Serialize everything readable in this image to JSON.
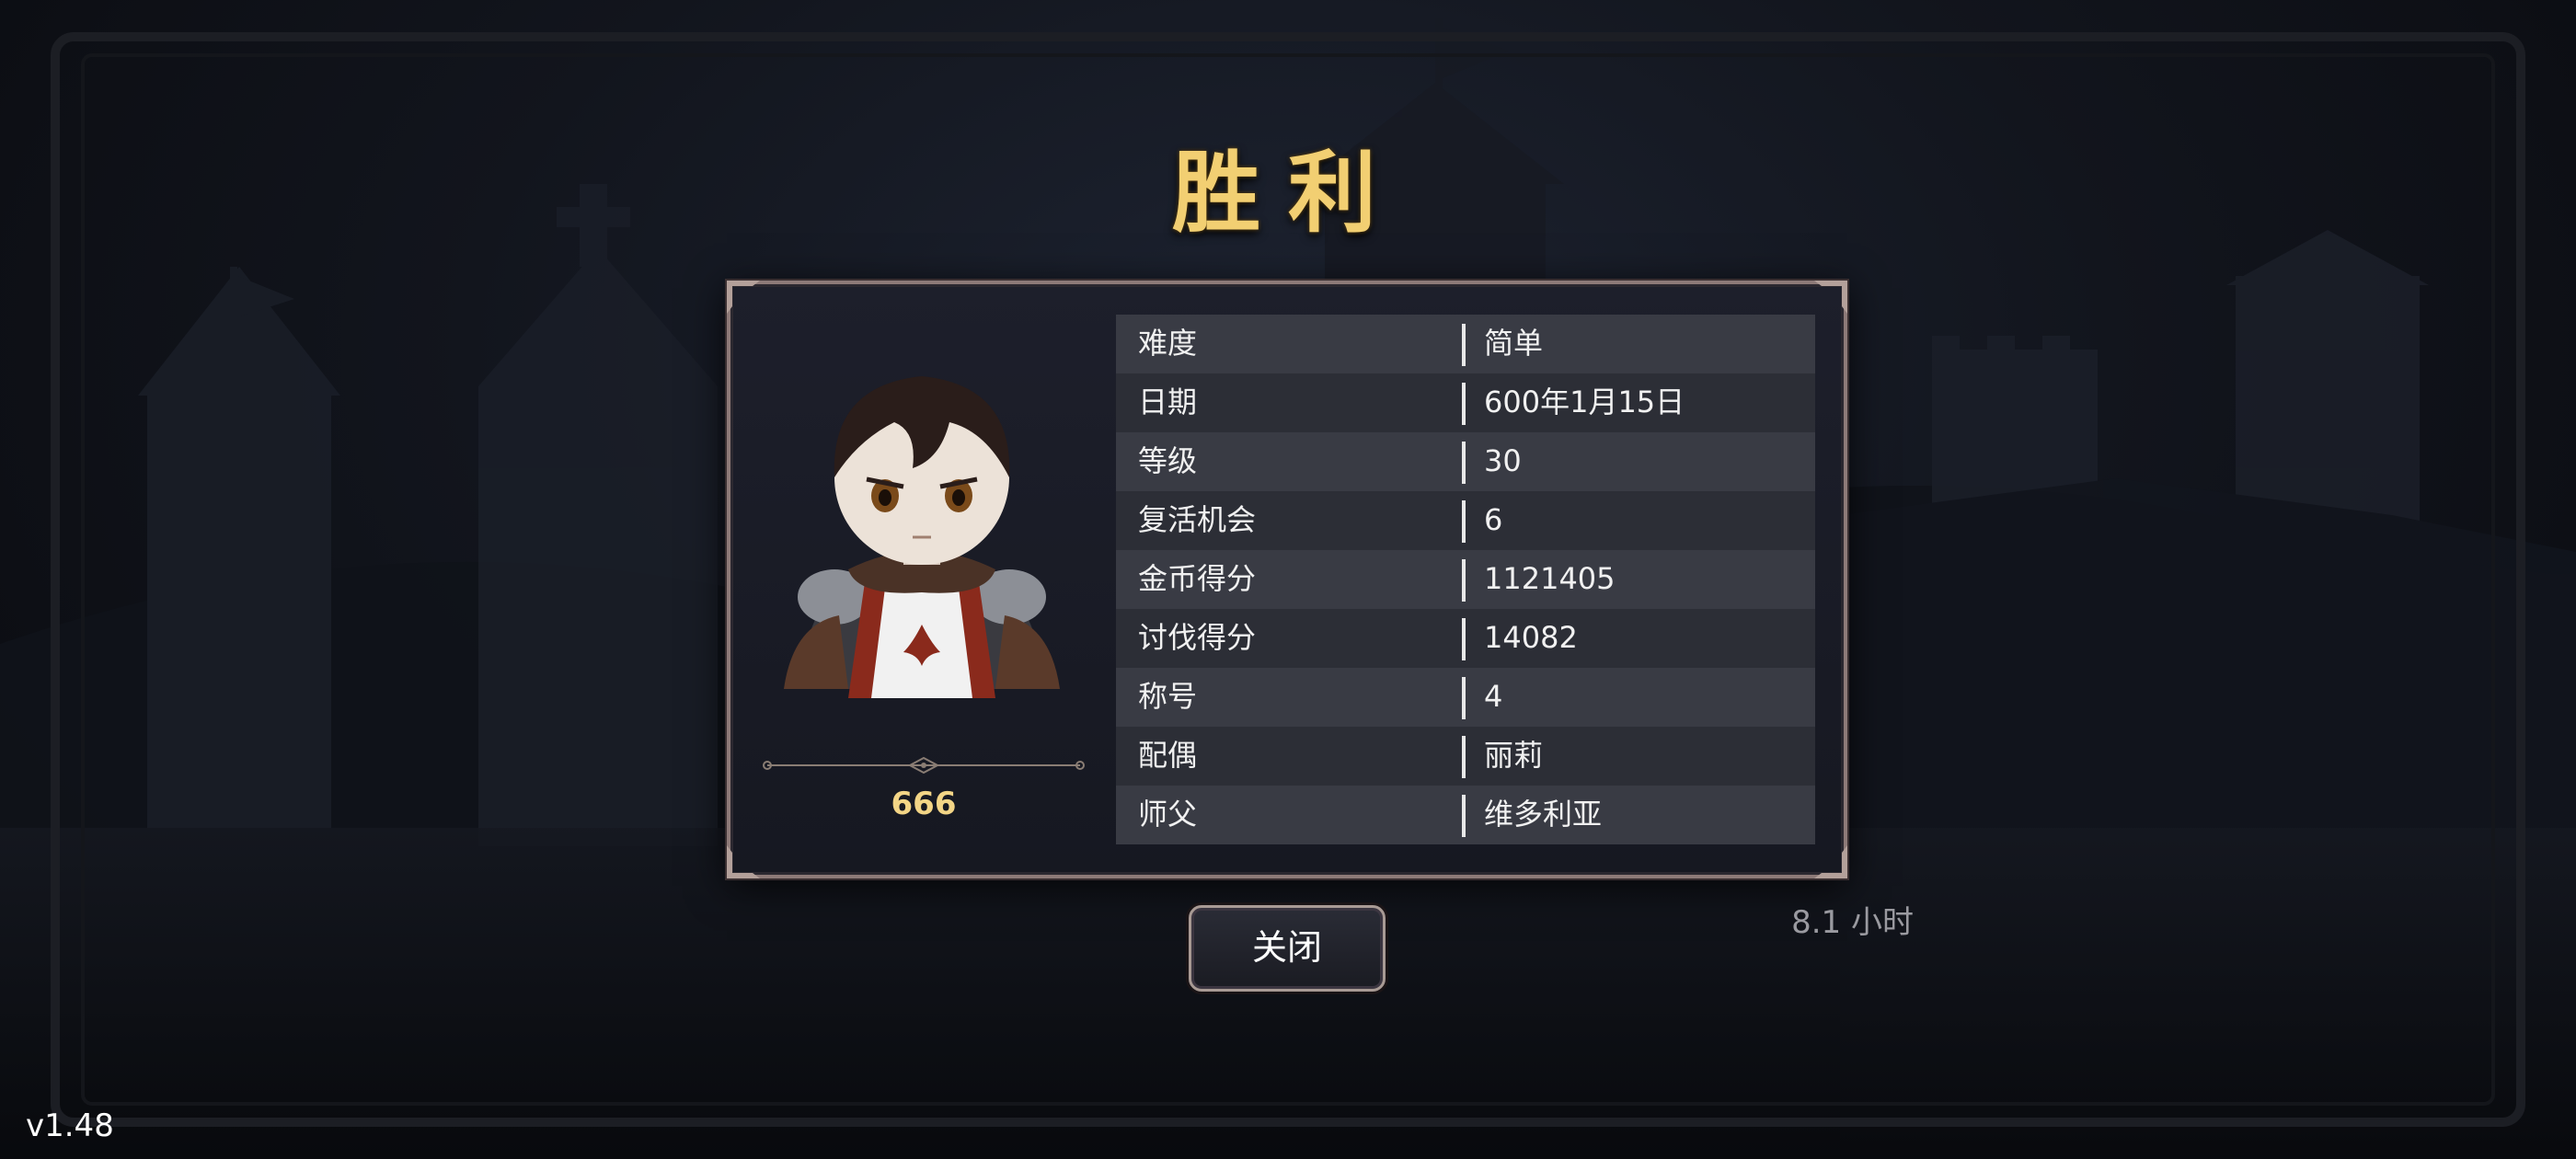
{
  "title": "胜利",
  "hero": {
    "score": "666"
  },
  "stats": [
    {
      "label": "难度",
      "value": "简单"
    },
    {
      "label": "日期",
      "value": "600年1月15日"
    },
    {
      "label": "等级",
      "value": "30"
    },
    {
      "label": "复活机会",
      "value": "6"
    },
    {
      "label": "金币得分",
      "value": "1121405"
    },
    {
      "label": "讨伐得分",
      "value": "14082"
    },
    {
      "label": "称号",
      "value": "4"
    },
    {
      "label": "配偶",
      "value": "丽莉"
    },
    {
      "label": "师父",
      "value": "维多利亚"
    }
  ],
  "close_button": {
    "label": "关闭"
  },
  "play_time": "8.1 小时",
  "version": "v1.48",
  "colors": {
    "title_gold": "#f2cf72",
    "score_gold": "#f3d586",
    "panel_border": "#8d7a78",
    "row_light": "#393b44",
    "row_dark": "#2c2e36"
  },
  "icons": [
    "knight-avatar-icon",
    "ornament-divider-icon",
    "corner-ornament-icon"
  ]
}
